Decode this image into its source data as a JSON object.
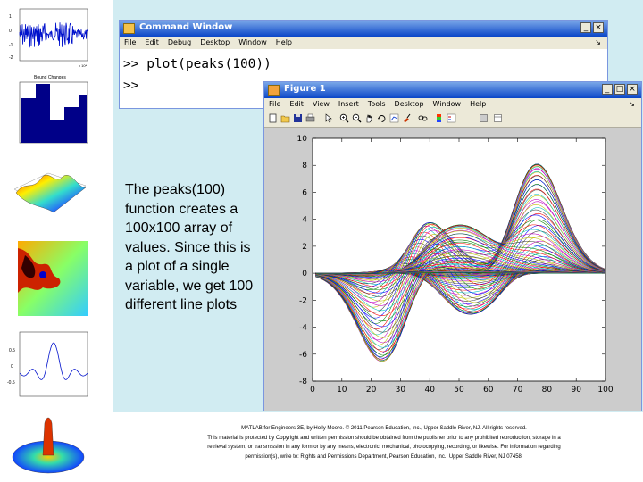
{
  "command_window": {
    "title": "Command Window",
    "menu": [
      "File",
      "Edit",
      "Debug",
      "Desktop",
      "Window",
      "Help"
    ],
    "command": ">> plot(peaks(100))",
    "prompt": ">>"
  },
  "figure_window": {
    "title": "Figure 1",
    "menu": [
      "File",
      "Edit",
      "View",
      "Insert",
      "Tools",
      "Desktop",
      "Window",
      "Help"
    ],
    "tools": [
      "new-icon",
      "open-icon",
      "save-icon",
      "print-icon",
      "arrow-icon",
      "zoom-in-icon",
      "zoom-out-icon",
      "pan-icon",
      "rotate-icon",
      "data-cursor-icon",
      "brush-icon",
      "link-icon",
      "colorbar-icon",
      "legend-icon",
      "hide-tools-icon",
      "show-tools-icon"
    ]
  },
  "description": "The peaks(100) function creates a 100x100 array of values. Since this is a plot of a single variable, we get 100 different line plots",
  "footer": [
    "MATLAB for Engineers 3E, by Holly Moore. © 2011 Pearson Education, Inc., Upper Saddle River, NJ. All rights reserved.",
    "This material is protected by Copyright and written permission should be obtained from the publisher prior to any prohibited reproduction, storage in a",
    "retrieval system, or transmission in any form or by any means, electronic, mechanical, photocopying, recording, or likewise. For information regarding",
    "permission(s), write to: Rights and Permissions Department, Pearson Education, Inc., Upper Saddle River, NJ 07458."
  ],
  "thumbnails": {
    "t1_ticks": [
      "1",
      "0",
      "-1",
      "-2"
    ],
    "t1_exp": "x 10⁴",
    "t2_title": "Bound Changes",
    "t4_ticks": [
      "0.5",
      "0",
      "-0.5"
    ]
  },
  "chart_data": {
    "type": "line",
    "series_count": 100,
    "x_range": [
      0,
      100
    ],
    "xlim": [
      0,
      100
    ],
    "ylim": [
      -8,
      10
    ],
    "xticks": [
      0,
      10,
      20,
      30,
      40,
      50,
      60,
      70,
      80,
      90,
      100
    ],
    "yticks": [
      -8,
      -6,
      -4,
      -2,
      0,
      2,
      4,
      6,
      8,
      10
    ],
    "function": "peaks(100)",
    "grid": false,
    "title": "",
    "xlabel": "",
    "ylabel": ""
  }
}
